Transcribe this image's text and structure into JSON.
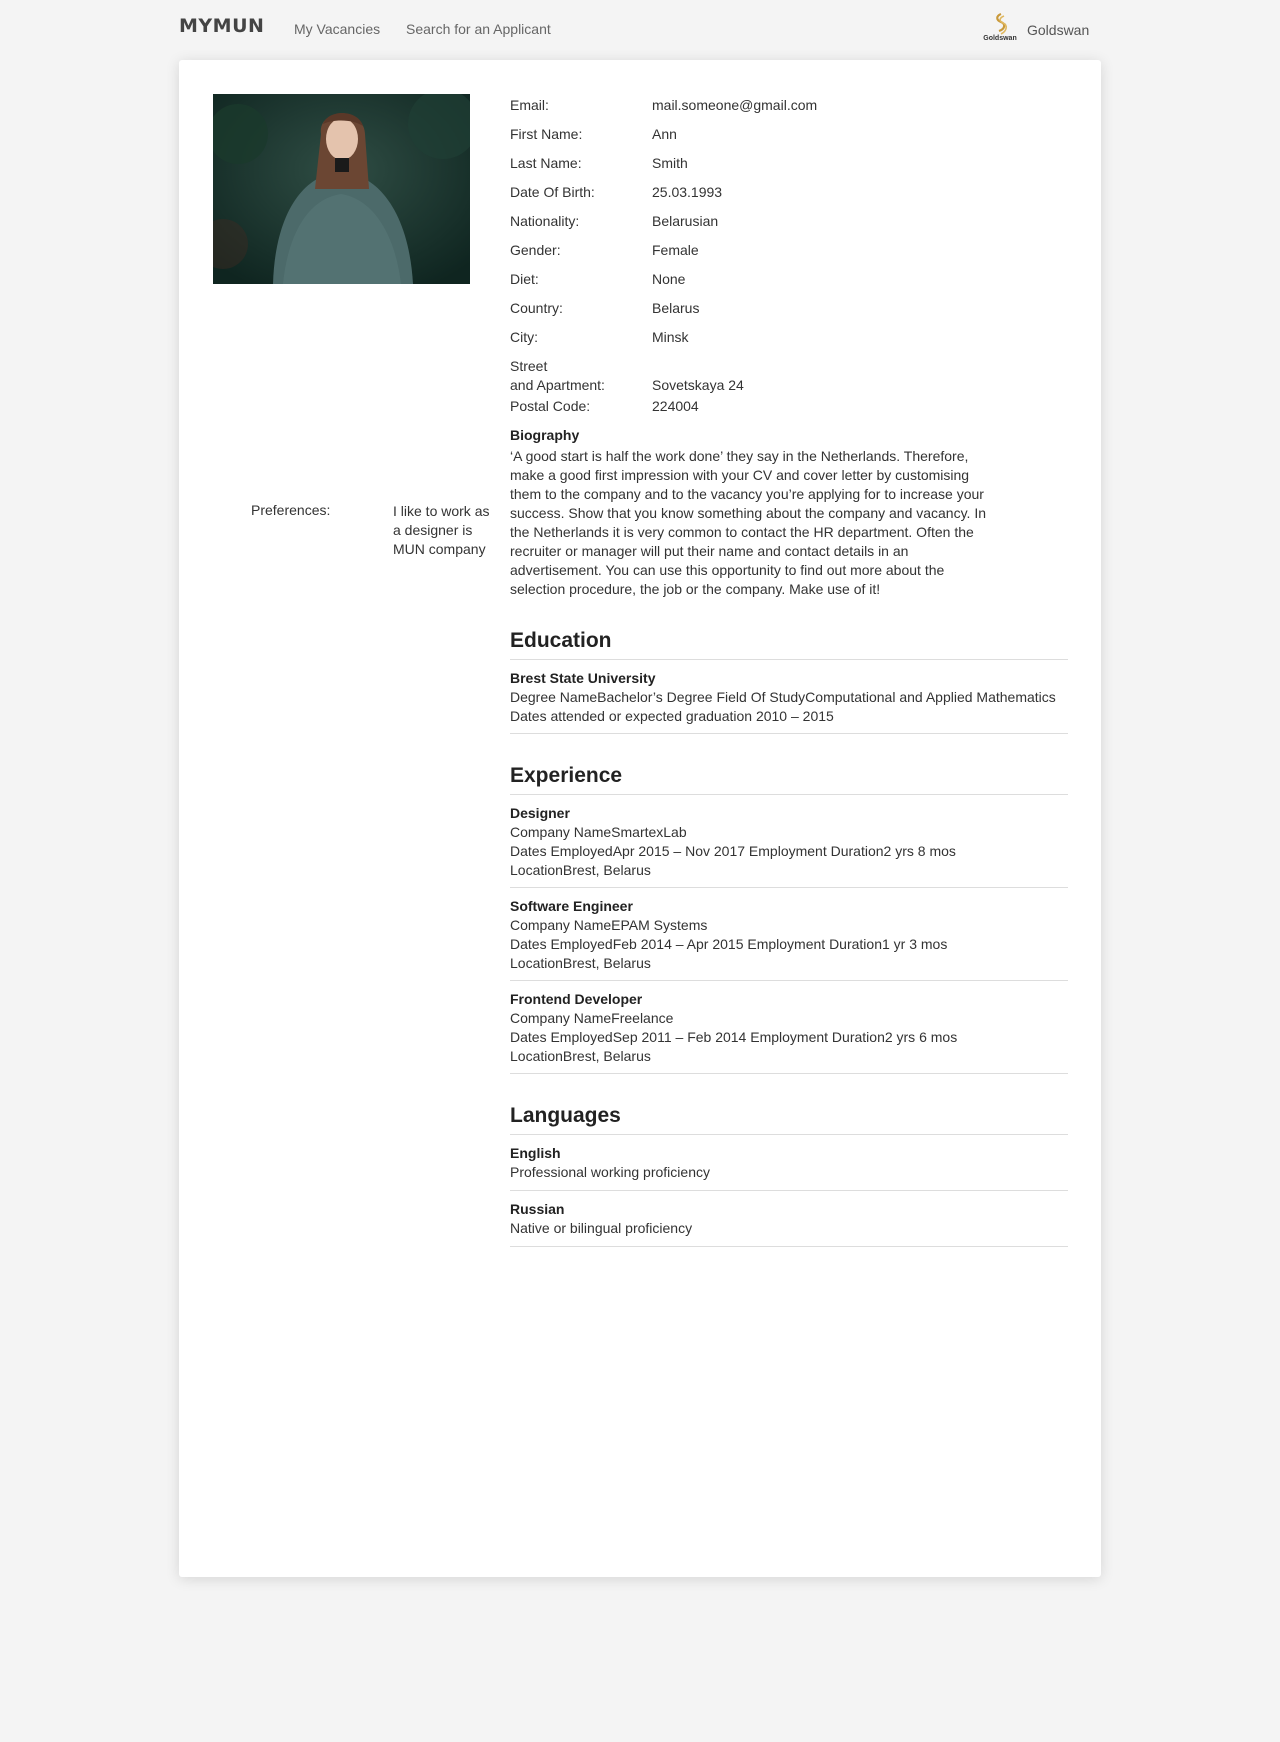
{
  "header": {
    "brand": "MYMUN",
    "nav": [
      "My Vacancies",
      "Search for an Applicant"
    ],
    "company": {
      "logo_text": "Goldswan",
      "name": "Goldswan"
    }
  },
  "profile": {
    "fields": [
      {
        "label": "Email:",
        "value": "mail.someone@gmail.com"
      },
      {
        "label": "First Name:",
        "value": "Ann"
      },
      {
        "label": "Last Name:",
        "value": "Smith"
      },
      {
        "label": "Date Of Birth:",
        "value": "25.03.1993"
      },
      {
        "label": "Nationality:",
        "value": "Belarusian"
      },
      {
        "label": "Gender:",
        "value": "Female"
      },
      {
        "label": "Diet:",
        "value": "None"
      },
      {
        "label": "Country:",
        "value": "Belarus"
      },
      {
        "label": "City:",
        "value": "Minsk"
      },
      {
        "label": "Street\nand Apartment:",
        "value": "Sovetskaya 24"
      },
      {
        "label": "Postal Code:",
        "value": "224004"
      }
    ],
    "preferences": {
      "label": "Preferences:",
      "value": "I like to work as a designer is MUN company"
    },
    "biography": {
      "title": "Biography",
      "text": "‘A good start is half the work done’ they say in the Netherlands. Therefore, make a good first impression with your CV and cover letter by customising them to the company and to the vacancy you’re applying for to increase your success. Show that you know something about the company and vacancy. In the Netherlands it is very common to contact the HR department. Often the recruiter or manager will put their name and contact details in an advertisement. You can use this opportunity to find out more about the selection procedure, the job or the company. Make use of it!"
    }
  },
  "education": {
    "title": "Education",
    "items": [
      {
        "school": "Brest State University",
        "degree": "Degree NameBachelor’s Degree Field Of StudyComputational and Applied Mathematics",
        "dates": "Dates attended or expected graduation 2010 – 2015"
      }
    ]
  },
  "experience": {
    "title": "Experience",
    "items": [
      {
        "role": "Designer",
        "company": "Company NameSmartexLab",
        "dates": "Dates EmployedApr 2015 – Nov 2017  Employment Duration2 yrs 8 mos",
        "location": "LocationBrest, Belarus"
      },
      {
        "role": "Software Engineer",
        "company": "Company NameEPAM Systems",
        "dates": "Dates EmployedFeb 2014 – Apr 2015  Employment Duration1 yr 3 mos",
        "location": "LocationBrest, Belarus"
      },
      {
        "role": "Frontend Developer",
        "company": "Company NameFreelance",
        "dates": "Dates EmployedSep 2011 – Feb 2014  Employment Duration2 yrs 6 mos",
        "location": "LocationBrest, Belarus"
      }
    ]
  },
  "languages": {
    "title": "Languages",
    "items": [
      {
        "name": "English",
        "level": "Professional working proficiency"
      },
      {
        "name": "Russian",
        "level": "Native or bilingual proficiency"
      }
    ]
  }
}
